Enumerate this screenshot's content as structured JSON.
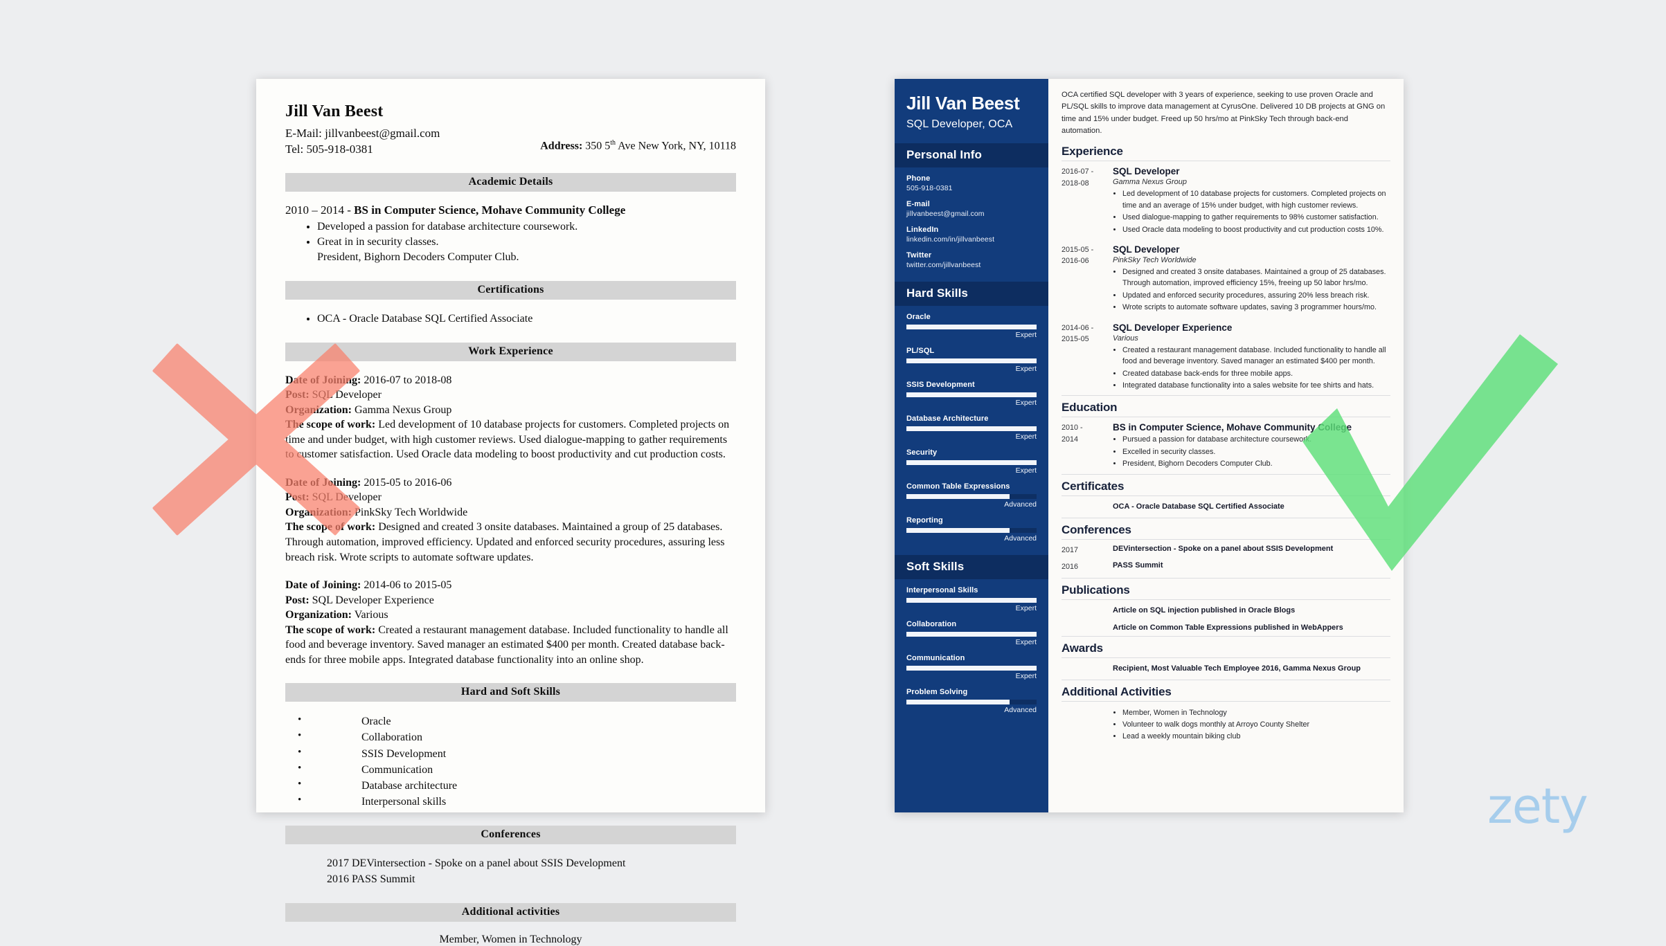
{
  "bad_resume": {
    "name": "Jill Van Beest",
    "email_line": "E-Mail: jillvanbeest@gmail.com",
    "tel_line": "Tel: 505-918-0381",
    "address_label": "Address:",
    "address_value_pre": "350 5",
    "address_sup": "th",
    "address_value_post": " Ave New York, NY, 10118",
    "sections": {
      "academic": "Academic Details",
      "certifications": "Certifications",
      "work": "Work Experience",
      "skills": "Hard and Soft Skills",
      "conferences": "Conferences",
      "additional": "Additional activities"
    },
    "education": {
      "heading_years": "2010 – 2014 - ",
      "heading_degree": "BS in Computer Science, Mohave Community College",
      "bullets": [
        "Developed a passion for database architecture coursework.",
        "Great in in security classes."
      ],
      "sub_line": "President, Bighorn Decoders Computer Club."
    },
    "certifications": [
      "OCA - Oracle Database SQL Certified Associate"
    ],
    "jobs": [
      {
        "date_label": "Date of Joining:",
        "date_value": " 2016-07 to 2018-08",
        "post_label": "Post:",
        "post_value": " SQL Developer",
        "org_label": "Organization:",
        "org_value": " Gamma Nexus Group",
        "scope_label": "The scope of work:",
        "scope_value": " Led development of 10 database projects for customers. Completed projects on time and under budget, with high customer reviews. Used dialogue-mapping to gather requirements to customer satisfaction. Used Oracle data modeling to boost productivity and cut production costs."
      },
      {
        "date_label": "Date of Joining:",
        "date_value": " 2015-05 to 2016-06",
        "post_label": "Post:",
        "post_value": " SQL Developer",
        "org_label": "Organization:",
        "org_value": " PinkSky Tech Worldwide",
        "scope_label": "The scope of work:",
        "scope_value": " Designed and created 3 onsite databases. Maintained a group of 25 databases. Through automation, improved efficiency. Updated and enforced security procedures, assuring less breach risk. Wrote scripts to automate software updates."
      },
      {
        "date_label": "Date of Joining:",
        "date_value": " 2014-06 to 2015-05",
        "post_label": "Post:",
        "post_value": " SQL Developer Experience",
        "org_label": "Organization:",
        "org_value": " Various",
        "scope_label": "The scope of work:",
        "scope_value": " Created a restaurant management database. Included functionality to handle all food and beverage inventory. Saved manager an estimated $400 per month. Created database back-ends for three mobile apps. Integrated database functionality into an online shop."
      }
    ],
    "skills": [
      "Oracle",
      "Collaboration",
      "SSIS Development",
      "Communication",
      "Database architecture",
      "Interpersonal skills"
    ],
    "conferences": [
      "2017 DEVintersection - Spoke on a panel about SSIS Development",
      "2016 PASS Summit"
    ],
    "additional": "Member, Women in Technology"
  },
  "good_resume": {
    "sidebar": {
      "name": "Jill Van Beest",
      "title": "SQL Developer, OCA",
      "personal_info_heading": "Personal Info",
      "contacts": [
        {
          "label": "Phone",
          "value": "505-918-0381"
        },
        {
          "label": "E-mail",
          "value": "jillvanbeest@gmail.com"
        },
        {
          "label": "LinkedIn",
          "value": "linkedin.com/in/jillvanbeest"
        },
        {
          "label": "Twitter",
          "value": "twitter.com/jillvanbeest"
        }
      ],
      "hard_skills_heading": "Hard Skills",
      "hard_skills": [
        {
          "name": "Oracle",
          "level": "Expert",
          "pct": 100
        },
        {
          "name": "PL/SQL",
          "level": "Expert",
          "pct": 100
        },
        {
          "name": "SSIS Development",
          "level": "Expert",
          "pct": 100
        },
        {
          "name": "Database Architecture",
          "level": "Expert",
          "pct": 100
        },
        {
          "name": "Security",
          "level": "Expert",
          "pct": 100
        },
        {
          "name": "Common Table Expressions",
          "level": "Advanced",
          "pct": 79
        },
        {
          "name": "Reporting",
          "level": "Advanced",
          "pct": 79
        }
      ],
      "soft_skills_heading": "Soft Skills",
      "soft_skills": [
        {
          "name": "Interpersonal Skills",
          "level": "Expert",
          "pct": 100
        },
        {
          "name": "Collaboration",
          "level": "Expert",
          "pct": 100
        },
        {
          "name": "Communication",
          "level": "Expert",
          "pct": 100
        },
        {
          "name": "Problem Solving",
          "level": "Advanced",
          "pct": 79
        }
      ]
    },
    "main": {
      "summary": "OCA certified SQL developer with 3 years of experience, seeking to use proven Oracle and PL/SQL skills to improve data management at CyrusOne. Delivered 10 DB projects at GNG on time and 15% under budget. Freed up 50 hrs/mo at PinkSky Tech through back-end automation.",
      "headings": {
        "experience": "Experience",
        "education": "Education",
        "certificates": "Certificates",
        "conferences": "Conferences",
        "publications": "Publications",
        "awards": "Awards",
        "additional": "Additional Activities"
      },
      "experience": [
        {
          "date": "2016-07 -\n2018-08",
          "role": "SQL Developer",
          "org": "Gamma Nexus Group",
          "bullets": [
            "Led development of 10 database projects for customers. Completed projects on time and an average of 15% under budget, with high customer reviews.",
            "Used dialogue-mapping to gather requirements to 98% customer satisfaction.",
            "Used Oracle data modeling to boost productivity and cut production costs 10%."
          ]
        },
        {
          "date": "2015-05 -\n2016-06",
          "role": "SQL Developer",
          "org": "PinkSky Tech Worldwide",
          "bullets": [
            "Designed and created 3 onsite databases. Maintained a group of 25 databases. Through automation, improved efficiency 15%, freeing up 50 labor hrs/mo.",
            "Updated and enforced security procedures, assuring 20% less breach risk.",
            "Wrote scripts to automate software updates, saving 3 programmer hours/mo."
          ]
        },
        {
          "date": "2014-06 -\n2015-05",
          "role": "SQL Developer Experience",
          "org": "Various",
          "bullets": [
            "Created a restaurant management database. Included functionality to handle all food and beverage inventory. Saved manager an estimated $400 per month.",
            "Created database back-ends for three mobile apps.",
            "Integrated database functionality into a sales website for tee shirts and hats."
          ]
        }
      ],
      "education": [
        {
          "date": "2010 -\n2014",
          "degree": "BS in Computer Science, Mohave Community College",
          "bullets": [
            "Pursued a passion for database architecture coursework.",
            "Excelled in security classes.",
            "President, Bighorn Decoders Computer Club."
          ]
        }
      ],
      "certificates": [
        "OCA - Oracle Database SQL Certified Associate"
      ],
      "conferences": [
        {
          "year": "2017",
          "text": "DEVintersection - Spoke on a panel about SSIS Development"
        },
        {
          "year": "2016",
          "text": "PASS Summit"
        }
      ],
      "publications": [
        "Article on SQL injection published in Oracle Blogs",
        "Article on Common Table Expressions published in WebAppers"
      ],
      "awards": [
        "Recipient, Most Valuable Tech Employee 2016, Gamma Nexus Group"
      ],
      "additional": [
        "Member, Women in Technology",
        "Volunteer to walk dogs monthly at Arroyo County Shelter",
        "Lead a weekly mountain biking club"
      ]
    }
  },
  "branding": {
    "logo_text": "zety"
  },
  "marks": {
    "reject_color": "#f9806c",
    "accept_color": "#5ee07a"
  }
}
